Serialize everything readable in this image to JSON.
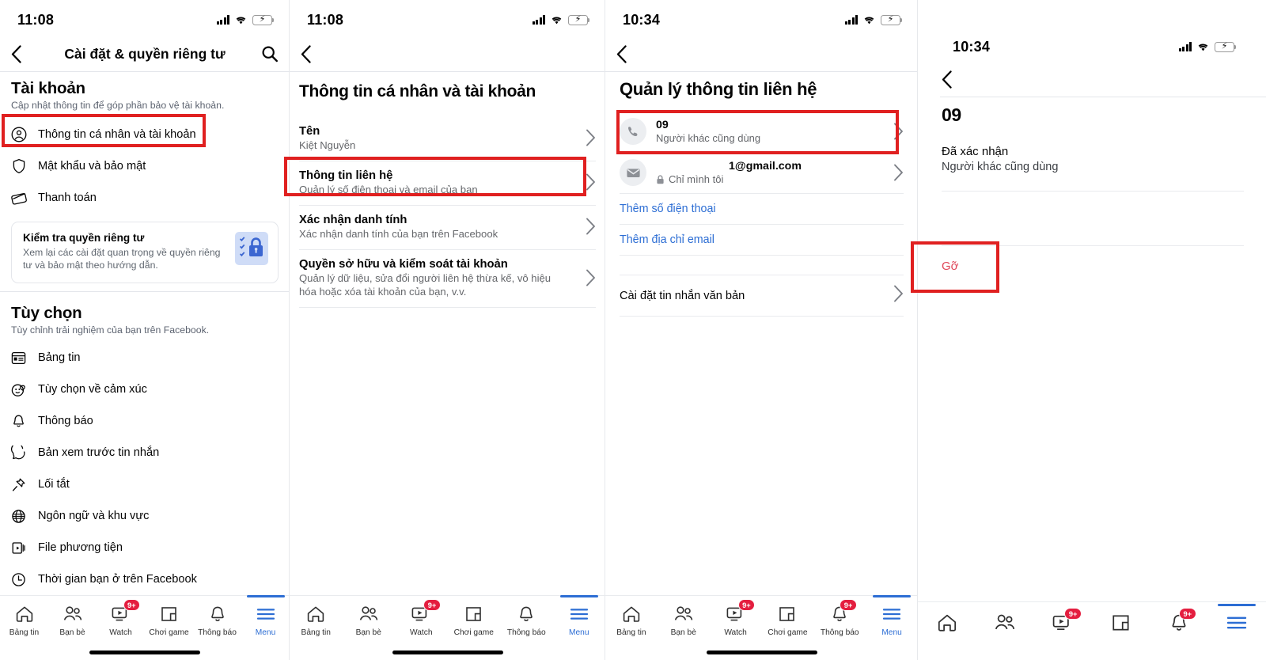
{
  "colors": {
    "accent": "#2d6ed4",
    "annotation": "#e02020",
    "badge": "#e41e3f",
    "danger_text": "#e0485a",
    "battery_green": "#3fcf5f",
    "card_icon_bg": "#cfdcf7",
    "text_primary": "#050505",
    "text_secondary": "#65676b"
  },
  "tabbar_labels": {
    "feed": "Bảng tin",
    "friends": "Bạn bè",
    "watch": "Watch",
    "gaming": "Chơi game",
    "notifications": "Thông báo",
    "menu": "Menu"
  },
  "badges": {
    "nine_plus": "9+"
  },
  "panel1": {
    "status": {
      "time": "11:08"
    },
    "nav": {
      "title": "Cài đặt & quyền riêng tư",
      "back_icon": "chevron-left-icon",
      "search_icon": "search-icon"
    },
    "account_section": {
      "title": "Tài khoản",
      "subtitle": "Cập nhật thông tin để góp phần bảo vệ tài khoản.",
      "items": [
        {
          "label": "Thông tin cá nhân và tài khoản",
          "icon": "person-circle-icon",
          "highlighted": true
        },
        {
          "label": "Mật khẩu và bảo mật",
          "icon": "shield-icon",
          "highlighted": false
        },
        {
          "label": "Thanh toán",
          "icon": "card-icon",
          "highlighted": false
        }
      ]
    },
    "privacy_card": {
      "title": "Kiểm tra quyền riêng tư",
      "body": "Xem lại các cài đặt quan trọng về quyền riêng tư và bảo mật theo hướng dẫn.",
      "icon": "privacy-checkup-lock-icon"
    },
    "options_section": {
      "title": "Tùy chọn",
      "subtitle": "Tùy chỉnh trải nghiệm của bạn trên Facebook.",
      "items": [
        {
          "label": "Bảng tin",
          "icon": "newsfeed-icon"
        },
        {
          "label": "Tùy chọn về cảm xúc",
          "icon": "reactions-icon"
        },
        {
          "label": "Thông báo",
          "icon": "bell-icon"
        },
        {
          "label": "Bản xem trước tin nhắn",
          "icon": "message-preview-icon"
        },
        {
          "label": "Lối tắt",
          "icon": "pin-icon"
        },
        {
          "label": "Ngôn ngữ và khu vực",
          "icon": "globe-icon"
        },
        {
          "label": "File phương tiện",
          "icon": "media-files-icon"
        },
        {
          "label": "Thời gian bạn ở trên Facebook",
          "icon": "clock-icon"
        }
      ]
    },
    "tabbar": {
      "active": "menu",
      "badges": {
        "watch": "9+"
      }
    }
  },
  "panel2": {
    "status": {
      "time": "11:08"
    },
    "nav": {
      "title": "",
      "back_icon": "chevron-left-icon"
    },
    "page_title": "Thông tin cá nhân và tài khoản",
    "rows": [
      {
        "title": "Tên",
        "subtitle": "Kiệt Nguyễn",
        "highlighted": false
      },
      {
        "title": "Thông tin liên hệ",
        "subtitle": "Quản lý số điện thoại và email của bạn",
        "highlighted": true
      },
      {
        "title": "Xác nhận danh tính",
        "subtitle": "Xác nhận danh tính của bạn trên Facebook",
        "highlighted": false
      },
      {
        "title": "Quyền sở hữu và kiểm soát tài khoản",
        "subtitle": "Quản lý dữ liệu, sửa đổi người liên hệ thừa kế, vô hiệu hóa hoặc xóa tài khoản của bạn, v.v.",
        "highlighted": false
      }
    ],
    "tabbar": {
      "active": "menu",
      "badges": {
        "watch": "9+"
      }
    }
  },
  "panel3": {
    "status": {
      "time": "10:34"
    },
    "nav": {
      "back_icon": "chevron-left-icon"
    },
    "page_title": "Quản lý thông tin liên hệ",
    "contacts": [
      {
        "value": "09",
        "meta": "Người khác cũng dùng",
        "icon": "phone-icon",
        "locked": false,
        "highlighted": true
      },
      {
        "value": "1@gmail.com",
        "meta": "Chỉ mình tôi",
        "icon": "envelope-icon",
        "locked": true,
        "highlighted": false
      }
    ],
    "links": [
      {
        "label": "Thêm số điện thoại"
      },
      {
        "label": "Thêm địa chỉ email"
      }
    ],
    "settings_row": {
      "label": "Cài đặt tin nhắn văn bản"
    },
    "tabbar": {
      "active": "menu",
      "badges": {
        "watch": "9+",
        "notifications": "9+"
      }
    }
  },
  "panel4": {
    "status": {
      "time": "10:34"
    },
    "nav": {
      "back_icon": "chevron-left-icon"
    },
    "page_title": "09",
    "status_title": "Đã xác nhận",
    "status_sub": "Người khác cũng dùng",
    "remove_button": {
      "label": "Gỡ",
      "highlighted": true
    },
    "tabbar": {
      "active": "menu",
      "badges": {
        "watch": "9+",
        "notifications": "9+"
      }
    }
  }
}
